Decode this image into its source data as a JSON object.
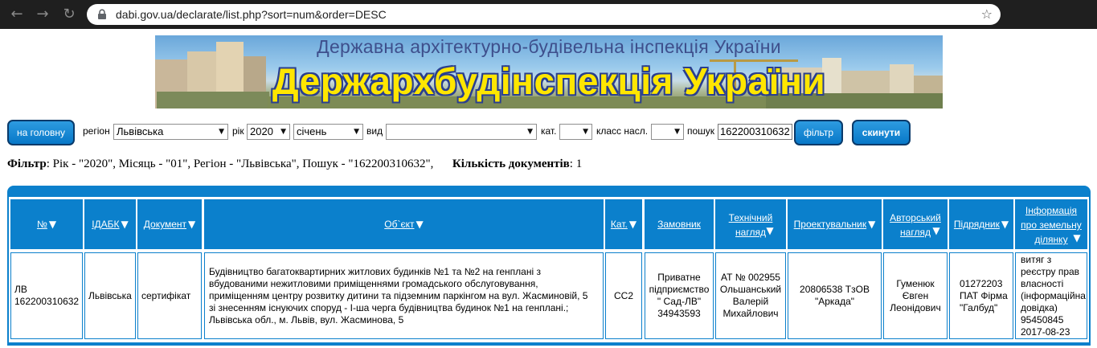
{
  "browser": {
    "url": "dabi.gov.ua/declarate/list.php?sort=num&order=DESC"
  },
  "banner": {
    "subtitle": "Державна архітектурно-будівельна інспекція України",
    "title": "Держархбудінспекція України"
  },
  "filter_bar": {
    "home_button": "на головну",
    "region_label": "регіон",
    "region_value": "Львівська",
    "year_label": "рік",
    "year_value": "2020",
    "month_value": "січень",
    "type_label": "вид",
    "type_value": "",
    "cat_label": "кат.",
    "cat_value": "",
    "class_label": "класс насл.",
    "class_value": "",
    "search_label": "пошук",
    "search_value": "162200310632",
    "filter_button": "фільтр",
    "reset_button": "скинути"
  },
  "summary": {
    "filter_label": "Фільтр",
    "filter_text": ": Рік - \"2020\", Місяць - \"01\", Регіон - \"Львівська\", Пошук - \"162200310632\",",
    "count_label": "Кількість документів",
    "count_text": ": 1"
  },
  "table": {
    "headers": {
      "num": "№",
      "idabk": "ІДАБК",
      "document": "Документ",
      "object": "Об`єкт",
      "cat": "Кат.",
      "customer": "Замовник",
      "tech_l1": "Технічний",
      "tech_l2": "нагляд",
      "designer": "Проектувальник",
      "author_l1": "Авторський",
      "author_l2": "нагляд",
      "contractor": "Підрядник",
      "land_l1": "Інформація",
      "land_l2": "про земельну",
      "land_l3": "ділянку"
    },
    "row": {
      "num_l1": "ЛВ",
      "num_l2": "162200310632",
      "idabk": "Львівська",
      "document": "сертифікат",
      "object_l1": "Будівництво багатоквартирних житлових будинків №1 та №2 на генплані з",
      "object_l2": "вбудованими нежитловими приміщеннями громадського обслуговування,",
      "object_l3": "приміщенням центру розвитку дитини та підземним паркінгом на вул. Жасминовій, 5",
      "object_l4": "зі знесенням існуючих споруд - І-ша черга будівництва будинок №1 на генплані.;",
      "object_l5": "Львівська обл., м. Львів, вул. Жасминова, 5",
      "cat": "СС2",
      "customer_l1": "Приватне",
      "customer_l2": "підприємство",
      "customer_l3": "\" Сад-ЛВ\"",
      "customer_l4": "34943593",
      "tech_l1": "АТ № 002955",
      "tech_l2": "Ольшанський",
      "tech_l3": "Валерій",
      "tech_l4": "Михайлович",
      "designer_l1": "20806538 ТзОВ",
      "designer_l2": "\"Аркада\"",
      "author_l1": "Гуменюк",
      "author_l2": "Євген",
      "author_l3": "Леонідович",
      "contractor_l1": "01272203",
      "contractor_l2": "ПАТ Фірма",
      "contractor_l3": "\"Галбуд\"",
      "land_l1": "витяг з",
      "land_l2": "реєстру прав",
      "land_l3": "власності",
      "land_l4": "(інформаційна",
      "land_l5": "довідка)",
      "land_l6": "95450845",
      "land_l7": "2017-08-23"
    }
  },
  "colors": {
    "accent": "#0b80cc",
    "banner_title": "#ffe600",
    "banner_subtitle": "#3e4f8c",
    "chrome": "#1f1f1f"
  },
  "icons": [
    "back-icon",
    "forward-icon",
    "reload-icon",
    "lock-icon",
    "bookmark-star-icon",
    "sort-triangle-icon",
    "dropdown-arrow-icon"
  ]
}
